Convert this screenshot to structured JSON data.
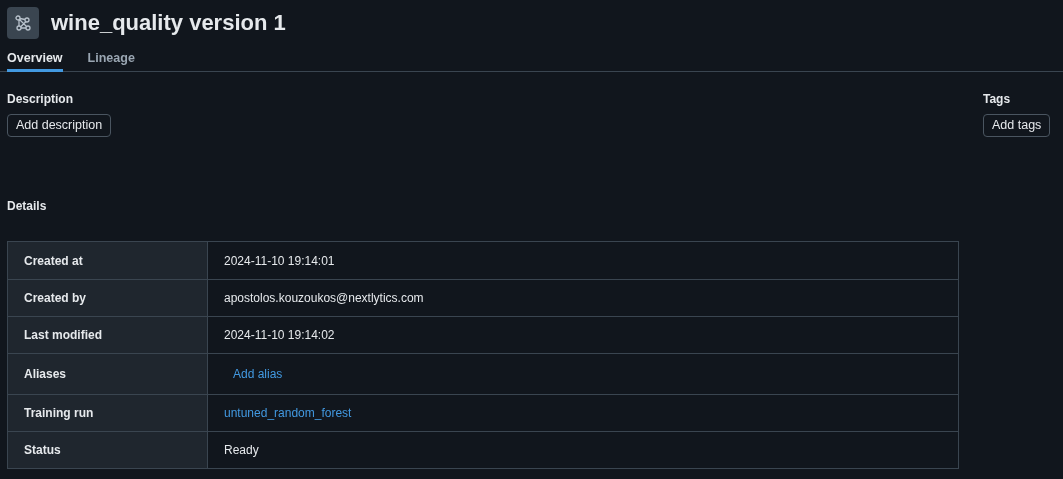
{
  "title": "wine_quality version 1",
  "tabs": [
    {
      "label": "Overview",
      "selected": true
    },
    {
      "label": "Lineage",
      "selected": false
    }
  ],
  "description": {
    "heading": "Description",
    "button": "Add description"
  },
  "tags": {
    "heading": "Tags",
    "button": "Add tags"
  },
  "details": {
    "heading": "Details",
    "rows": [
      {
        "label": "Created at",
        "kind": "text",
        "value": "2024-11-10 19:14:01"
      },
      {
        "label": "Created by",
        "kind": "text",
        "value": "apostolos.kouzoukos@nextlytics.com"
      },
      {
        "label": "Last modified",
        "kind": "text",
        "value": "2024-11-10 19:14:02"
      },
      {
        "label": "Aliases",
        "kind": "action",
        "value": "Add alias"
      },
      {
        "label": "Training run",
        "kind": "link",
        "value": "untuned_random_forest"
      },
      {
        "label": "Status",
        "kind": "text",
        "value": "Ready"
      }
    ]
  }
}
